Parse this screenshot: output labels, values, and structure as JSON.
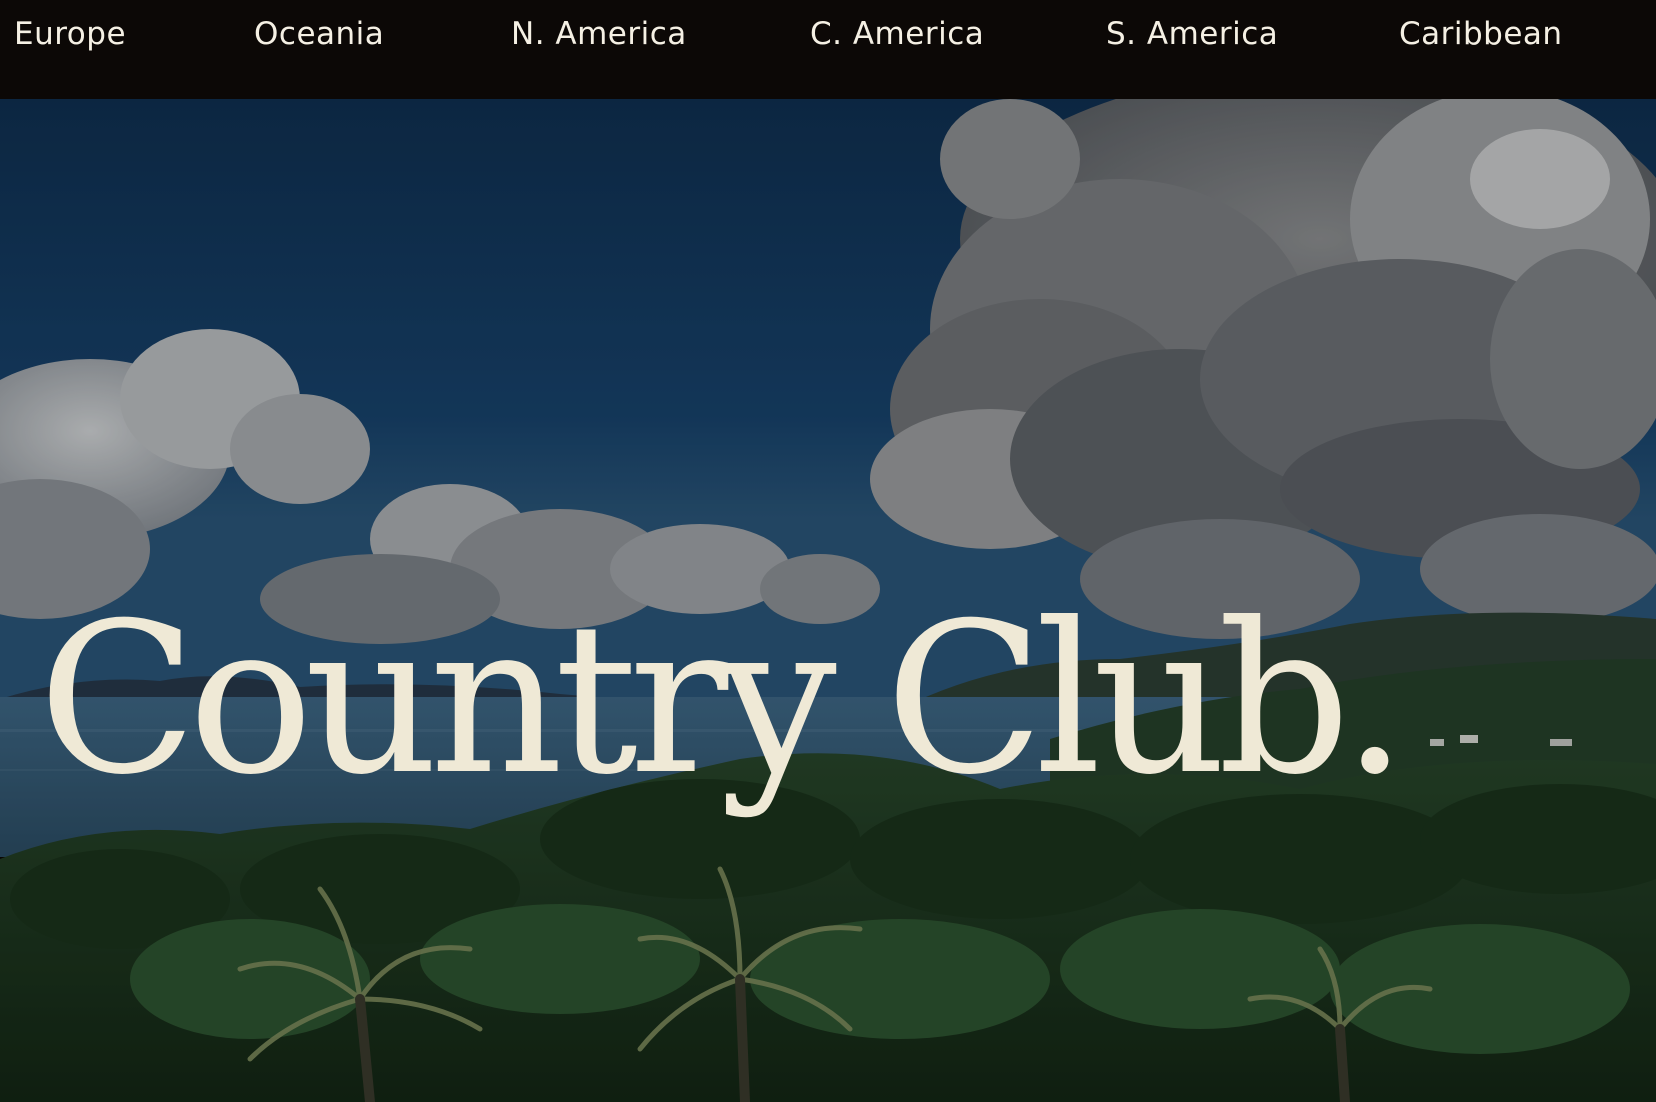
{
  "nav": {
    "items": [
      {
        "label": "Europe"
      },
      {
        "label": "Oceania"
      },
      {
        "label": "N. America"
      },
      {
        "label": "C. America"
      },
      {
        "label": "S. America"
      },
      {
        "label": "Caribbean"
      }
    ]
  },
  "hero": {
    "title": "Country Club.",
    "image": "tropical-island-landscape"
  },
  "colors": {
    "nav_background": "#0c0806",
    "nav_text": "#f5f0e4",
    "title_text": "#efe9d6",
    "sky": "#163a5e",
    "foliage": "#1d3a1f"
  }
}
